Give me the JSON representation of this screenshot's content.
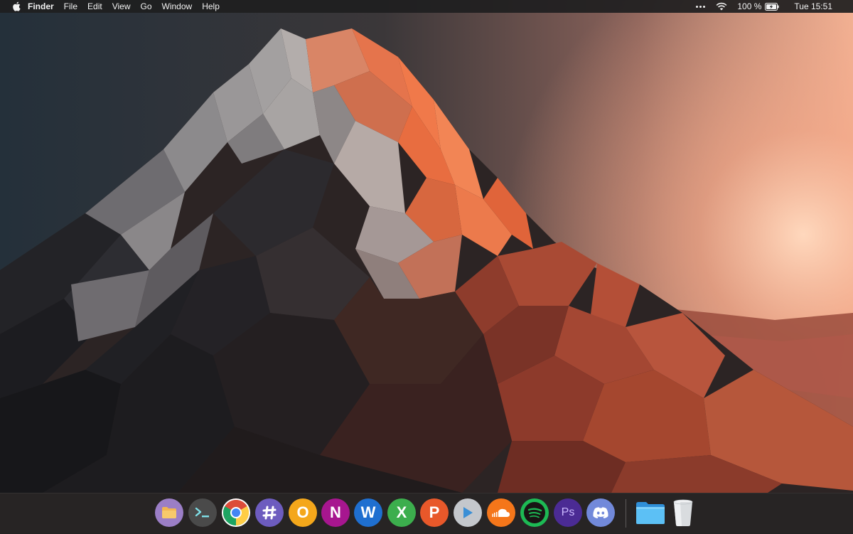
{
  "menubar": {
    "app_name": "Finder",
    "menus": [
      "File",
      "Edit",
      "View",
      "Go",
      "Window",
      "Help"
    ],
    "battery_label": "100 %",
    "clock": "Tue 15:51",
    "icons": [
      "apple-icon",
      "more-dots-icon",
      "wifi-icon",
      "battery-charging-icon"
    ]
  },
  "dock": {
    "apps": [
      {
        "name": "Files",
        "icon": "folder-icon",
        "color": "#9b7ec6"
      },
      {
        "name": "Terminal",
        "icon": "terminal-icon",
        "color": "#4a4a4a"
      },
      {
        "name": "Chrome",
        "icon": "chrome-icon",
        "color": "#dd4b39"
      },
      {
        "name": "Slack",
        "icon": "slack-icon",
        "color": "#6d5cbf"
      },
      {
        "name": "Outlook",
        "icon": "outlook-icon",
        "color": "#f4a71b",
        "letter": "O"
      },
      {
        "name": "OneNote",
        "icon": "onenote-icon",
        "color": "#a7168f",
        "letter": "N"
      },
      {
        "name": "Word",
        "icon": "word-icon",
        "color": "#1f6fd0",
        "letter": "W"
      },
      {
        "name": "Excel",
        "icon": "excel-icon",
        "color": "#3cae4d",
        "letter": "X"
      },
      {
        "name": "PowerPoint",
        "icon": "powerpoint-icon",
        "color": "#e8582a",
        "letter": "P"
      },
      {
        "name": "Media Player",
        "icon": "play-icon",
        "color": "#c4c7cc"
      },
      {
        "name": "SoundCloud",
        "icon": "soundcloud-icon",
        "color": "#f5761a"
      },
      {
        "name": "Spotify",
        "icon": "spotify-icon",
        "color": "#1db954"
      },
      {
        "name": "Photoshop",
        "icon": "photoshop-icon",
        "color": "#4b2b94",
        "letter": "Ps"
      },
      {
        "name": "Discord",
        "icon": "discord-icon",
        "color": "#7289da"
      }
    ],
    "pinned": [
      {
        "name": "Folder",
        "icon": "blue-folder-icon",
        "color": "#4fb3ee"
      },
      {
        "name": "Trash",
        "icon": "trash-icon",
        "color": "#e4e6e8"
      }
    ]
  }
}
